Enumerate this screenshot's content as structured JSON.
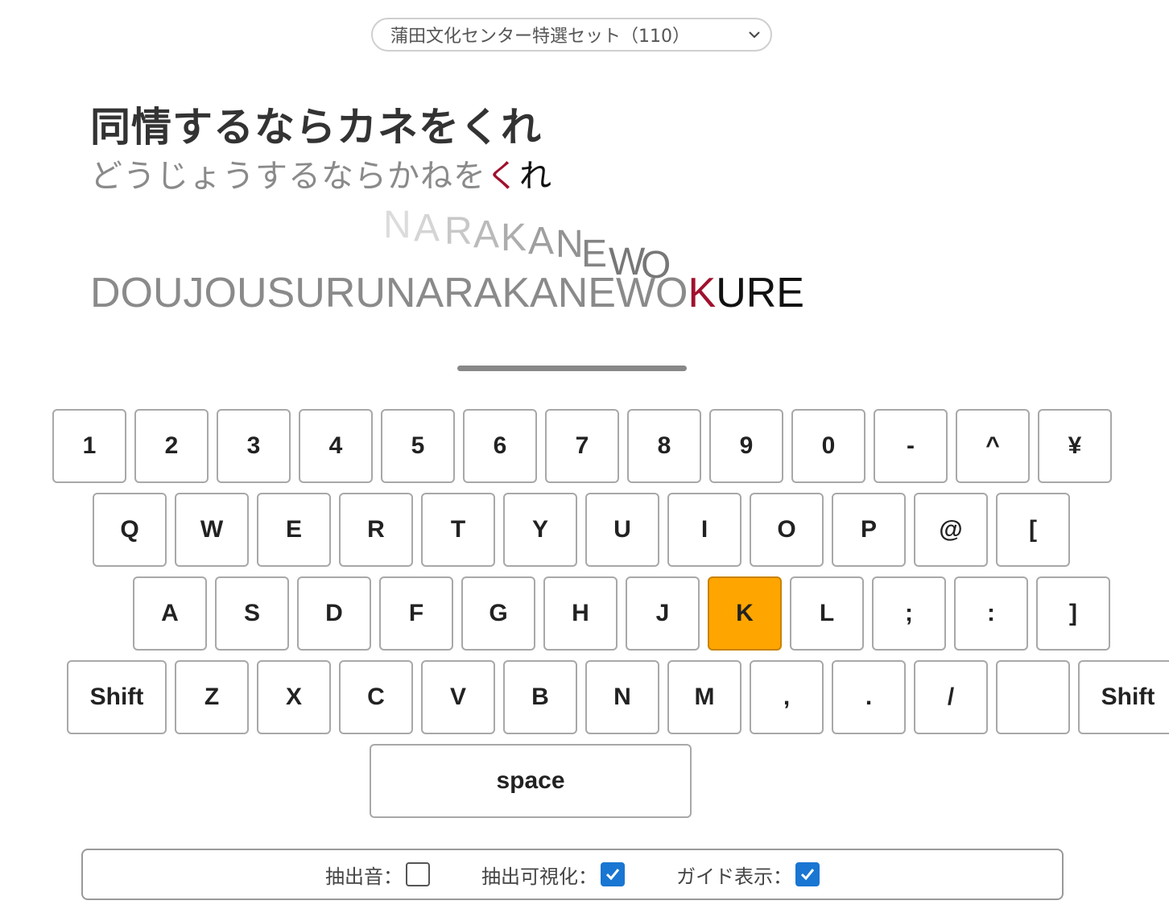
{
  "set_select": {
    "value": "蒲田文化センター特選セット（110）"
  },
  "title": "同情するならカネをくれ",
  "kana": {
    "typed": "どうじょうするならかねを",
    "current": "く",
    "rest": "れ"
  },
  "floating": [
    "N",
    "A",
    "R",
    "A",
    "K",
    "A",
    "N",
    "E",
    "W",
    "O"
  ],
  "romaji": {
    "typed": "DOUJOUSURUNARAKANEWO",
    "current": "K",
    "rest": "URE"
  },
  "keyboard": {
    "row1": [
      "1",
      "2",
      "3",
      "4",
      "5",
      "6",
      "7",
      "8",
      "9",
      "0",
      "-",
      "^",
      "¥"
    ],
    "row2": [
      "Q",
      "W",
      "E",
      "R",
      "T",
      "Y",
      "U",
      "I",
      "O",
      "P",
      "@",
      "["
    ],
    "row3": [
      "A",
      "S",
      "D",
      "F",
      "G",
      "H",
      "J",
      "K",
      "L",
      ";",
      ":",
      "]"
    ],
    "row4": [
      "Shift",
      "Z",
      "X",
      "C",
      "V",
      "B",
      "N",
      "M",
      ",",
      ".",
      "/",
      "",
      "Shift"
    ],
    "space": "space",
    "active_key": "K",
    "active_color": "#ffa500"
  },
  "options": [
    {
      "label": "抽出音：",
      "checked": false
    },
    {
      "label": "抽出可視化：",
      "checked": true
    },
    {
      "label": "ガイド表示：",
      "checked": true
    }
  ]
}
